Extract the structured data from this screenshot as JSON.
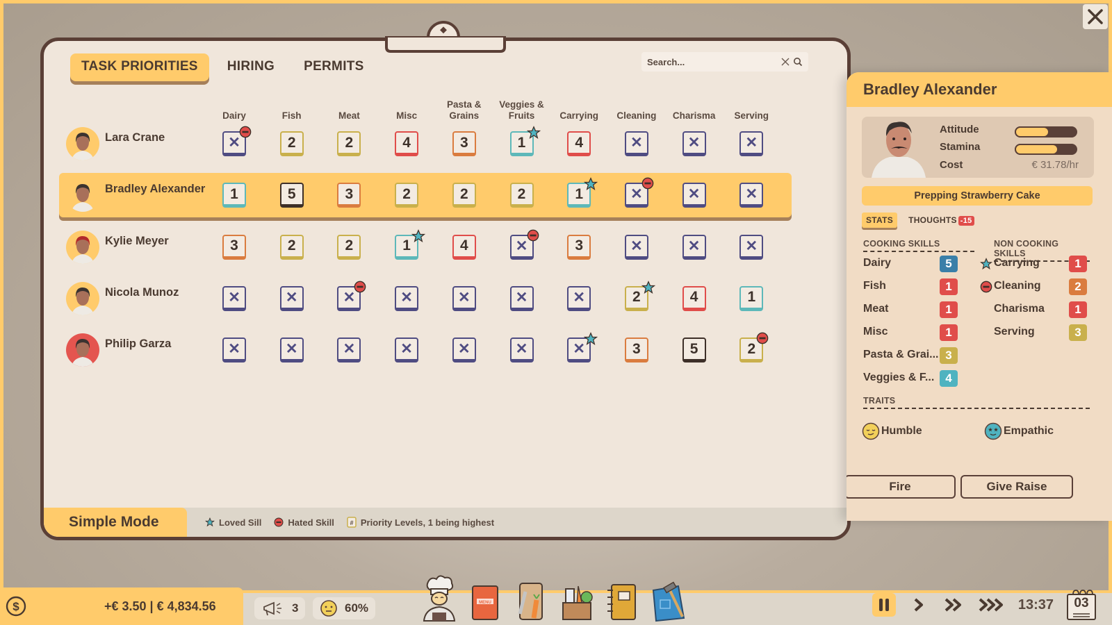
{
  "tabs": [
    {
      "label": "TASK PRIORITIES",
      "active": true
    },
    {
      "label": "HIRING",
      "active": false
    },
    {
      "label": "PERMITS",
      "active": false
    }
  ],
  "search": {
    "placeholder": "Search...",
    "value": ""
  },
  "columns": [
    "Dairy",
    "Fish",
    "Meat",
    "Misc",
    "Pasta & Grains",
    "Veggies & Fruits",
    "Carrying",
    "Cleaning",
    "Charisma",
    "Serving"
  ],
  "employees": [
    {
      "name": "Lara Crane",
      "selected": false,
      "avatar_bg": "#ffcb6b",
      "priorities": [
        {
          "v": "X",
          "mark": "hated"
        },
        {
          "v": "2"
        },
        {
          "v": "2"
        },
        {
          "v": "4"
        },
        {
          "v": "3"
        },
        {
          "v": "1",
          "mark": "loved"
        },
        {
          "v": "4"
        },
        {
          "v": "X"
        },
        {
          "v": "X"
        },
        {
          "v": "X"
        }
      ]
    },
    {
      "name": "Bradley Alexander",
      "selected": true,
      "avatar_bg": "transparent",
      "priorities": [
        {
          "v": "1"
        },
        {
          "v": "5"
        },
        {
          "v": "3"
        },
        {
          "v": "2"
        },
        {
          "v": "2"
        },
        {
          "v": "2"
        },
        {
          "v": "1",
          "mark": "loved"
        },
        {
          "v": "X",
          "mark": "hated"
        },
        {
          "v": "X"
        },
        {
          "v": "X"
        }
      ]
    },
    {
      "name": "Kylie Meyer",
      "selected": false,
      "avatar_bg": "#ffcb6b",
      "priorities": [
        {
          "v": "3"
        },
        {
          "v": "2"
        },
        {
          "v": "2"
        },
        {
          "v": "1",
          "mark": "loved"
        },
        {
          "v": "4"
        },
        {
          "v": "X",
          "mark": "hated"
        },
        {
          "v": "3"
        },
        {
          "v": "X"
        },
        {
          "v": "X"
        },
        {
          "v": "X"
        }
      ]
    },
    {
      "name": "Nicola Munoz",
      "selected": false,
      "avatar_bg": "#ffcb6b",
      "priorities": [
        {
          "v": "X"
        },
        {
          "v": "X"
        },
        {
          "v": "X",
          "mark": "hated"
        },
        {
          "v": "X"
        },
        {
          "v": "X"
        },
        {
          "v": "X"
        },
        {
          "v": "X"
        },
        {
          "v": "2",
          "mark": "loved"
        },
        {
          "v": "4"
        },
        {
          "v": "1"
        }
      ]
    },
    {
      "name": "Philip Garza",
      "selected": false,
      "avatar_bg": "#e4554f",
      "priorities": [
        {
          "v": "X"
        },
        {
          "v": "X"
        },
        {
          "v": "X"
        },
        {
          "v": "X"
        },
        {
          "v": "X"
        },
        {
          "v": "X"
        },
        {
          "v": "X",
          "mark": "loved"
        },
        {
          "v": "3"
        },
        {
          "v": "5"
        },
        {
          "v": "2",
          "mark": "hated"
        }
      ]
    }
  ],
  "footer": {
    "simple_mode": "Simple Mode",
    "legend_loved": "Loved Sill",
    "legend_hated": "Hated Skill",
    "legend_priority": "Priority Levels, 1 being highest"
  },
  "detail": {
    "name": "Bradley Alexander",
    "attitude_label": "Attitude",
    "attitude_value": 0.55,
    "stamina_label": "Stamina",
    "stamina_value": 0.7,
    "cost_label": "Cost",
    "cost_value": "€ 31.78/hr",
    "activity": "Prepping Strawberry Cake",
    "subtabs": {
      "stats": "STATS",
      "thoughts": "THOUGHTS",
      "thoughts_badge": "-15"
    },
    "cooking_title": "COOKING SKILLS",
    "non_cooking_title": "NON COOKING SKILLS",
    "cooking_skills": [
      {
        "name": "Dairy",
        "level": "5",
        "color": "#3a7fa8"
      },
      {
        "name": "Fish",
        "level": "1",
        "color": "#e04d4a"
      },
      {
        "name": "Meat",
        "level": "1",
        "color": "#e04d4a"
      },
      {
        "name": "Misc",
        "level": "1",
        "color": "#e04d4a"
      },
      {
        "name": "Pasta & Grai...",
        "level": "3",
        "color": "#c9b04c"
      },
      {
        "name": "Veggies & F...",
        "level": "4",
        "color": "#4fb3c0"
      }
    ],
    "non_cooking_skills": [
      {
        "name": "Carrying",
        "level": "1",
        "color": "#e04d4a",
        "mark": "loved"
      },
      {
        "name": "Cleaning",
        "level": "2",
        "color": "#da7c3f",
        "mark": "hated"
      },
      {
        "name": "Charisma",
        "level": "1",
        "color": "#e04d4a",
        "mark": ""
      },
      {
        "name": "Serving",
        "level": "3",
        "color": "#c9b04c",
        "mark": ""
      }
    ],
    "traits_title": "TRAITS",
    "traits": [
      {
        "name": "Humble",
        "icon": "humble-face-icon"
      },
      {
        "name": "Empathic",
        "icon": "empathic-face-icon"
      }
    ],
    "fire_label": "Fire",
    "raise_label": "Give Raise"
  },
  "hud": {
    "money": "+€ 3.50 | € 4,834.56",
    "marketing_count": "3",
    "satisfaction": "60%",
    "time": "13:37",
    "day": "03",
    "dock": [
      "staff",
      "menu",
      "prep",
      "ingredients",
      "recipes",
      "build"
    ]
  },
  "colors": {
    "accent": "#ffcb6b",
    "priority_1": "#5db8b9",
    "priority_2": "#c9b04c",
    "priority_3": "#da7c3f",
    "priority_4": "#e04d4a",
    "priority_5": "#3d2f28",
    "disabled": "#4f4c82"
  }
}
